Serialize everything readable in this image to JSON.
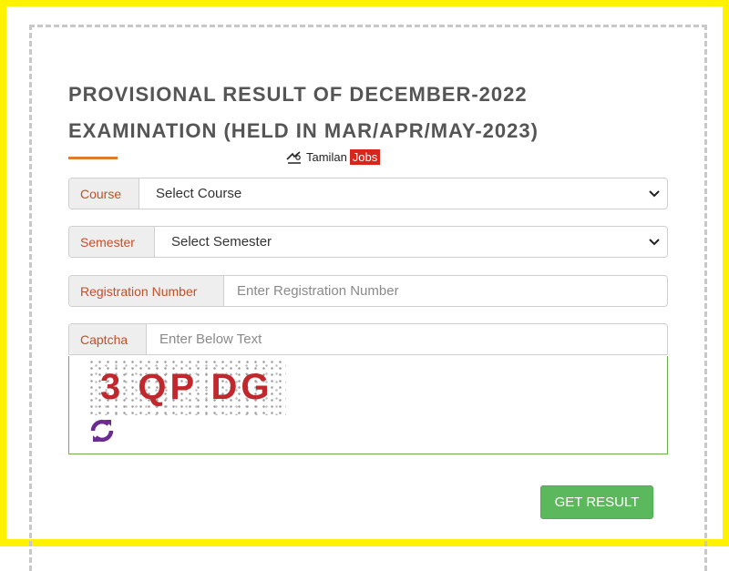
{
  "heading": {
    "line1": "PROVISIONAL RESULT OF DECEMBER-2022",
    "line2": "EXAMINATION (HELD IN MAR/APR/MAY-2023)"
  },
  "watermark": {
    "part1": "Tamilan",
    "part2": "Jobs"
  },
  "form": {
    "course": {
      "label": "Course",
      "value": "Select Course"
    },
    "semester": {
      "label": "Semester",
      "value": "Select Semester"
    },
    "registration": {
      "label": "Registration Number",
      "placeholder": "Enter Registration Number"
    },
    "captcha": {
      "label": "Captcha",
      "placeholder": "Enter Below Text",
      "image_text": "3 QP DG"
    },
    "submit_label": "GET RESULT"
  },
  "colors": {
    "frame": "#fff200",
    "title": "#555555",
    "accent_underline": "#e07b2c",
    "addon_text": "#c0502a",
    "button": "#5cb85c",
    "captcha_text": "#c0282d",
    "refresh_icon": "#6a2c91"
  },
  "icons": {
    "refresh": "refresh-icon",
    "dropdown": "chevron-down-icon"
  }
}
